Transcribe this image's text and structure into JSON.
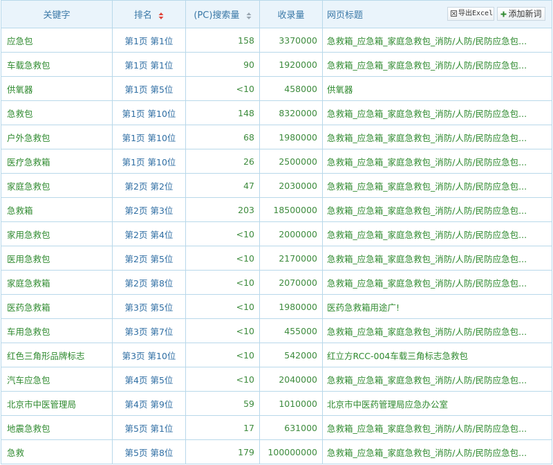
{
  "header": {
    "keyword": "关键字",
    "rank": "排名",
    "search_volume": "(PC)搜索量",
    "index_volume": "收录量",
    "page_title": "网页标题",
    "export_button": "导出Excel",
    "add_button": "添加新词"
  },
  "colors": {
    "header_bg": "#eaf4fb",
    "border": "#b8d8ea",
    "green_text": "#2f8a2f",
    "blue_text": "#2f6ea3",
    "sort_active": "#e0463c",
    "sort_inactive": "#9aa7b2"
  },
  "rows": [
    {
      "keyword": "应急包",
      "rank": "第1页 第1位",
      "search": "158",
      "index": "3370000",
      "title": "急救箱_应急箱_家庭急救包_消防/人防/民防应急包..."
    },
    {
      "keyword": "车载急救包",
      "rank": "第1页 第1位",
      "search": "90",
      "index": "1920000",
      "title": "急救箱_应急箱_家庭急救包_消防/人防/民防应急包..."
    },
    {
      "keyword": "供氧器",
      "rank": "第1页 第5位",
      "search": "<10",
      "index": "458000",
      "title": "供氧器"
    },
    {
      "keyword": "急救包",
      "rank": "第1页 第10位",
      "search": "148",
      "index": "8320000",
      "title": "急救箱_应急箱_家庭急救包_消防/人防/民防应急包..."
    },
    {
      "keyword": "户外急救包",
      "rank": "第1页 第10位",
      "search": "68",
      "index": "1980000",
      "title": "急救箱_应急箱_家庭急救包_消防/人防/民防应急包..."
    },
    {
      "keyword": "医疗急救箱",
      "rank": "第1页 第10位",
      "search": "26",
      "index": "2500000",
      "title": "急救箱_应急箱_家庭急救包_消防/人防/民防应急包..."
    },
    {
      "keyword": "家庭急救包",
      "rank": "第2页 第2位",
      "search": "47",
      "index": "2030000",
      "title": "急救箱_应急箱_家庭急救包_消防/人防/民防应急包..."
    },
    {
      "keyword": "急救箱",
      "rank": "第2页 第3位",
      "search": "203",
      "index": "18500000",
      "title": "急救箱_应急箱_家庭急救包_消防/人防/民防应急包..."
    },
    {
      "keyword": "家用急救包",
      "rank": "第2页 第4位",
      "search": "<10",
      "index": "2000000",
      "title": "急救箱_应急箱_家庭急救包_消防/人防/民防应急包..."
    },
    {
      "keyword": "医用急救包",
      "rank": "第2页 第5位",
      "search": "<10",
      "index": "2170000",
      "title": "急救箱_应急箱_家庭急救包_消防/人防/民防应急包..."
    },
    {
      "keyword": "家庭急救箱",
      "rank": "第2页 第8位",
      "search": "<10",
      "index": "2070000",
      "title": "急救箱_应急箱_家庭急救包_消防/人防/民防应急包..."
    },
    {
      "keyword": "医药急救箱",
      "rank": "第3页 第5位",
      "search": "<10",
      "index": "1980000",
      "title": "医药急救箱用途广!"
    },
    {
      "keyword": "车用急救包",
      "rank": "第3页 第7位",
      "search": "<10",
      "index": "455000",
      "title": "急救箱_应急箱_家庭急救包_消防/人防/民防应急包..."
    },
    {
      "keyword": "红色三角形品牌标志",
      "rank": "第3页 第10位",
      "search": "<10",
      "index": "542000",
      "title": "红立方RCC-004车载三角标志急救包"
    },
    {
      "keyword": "汽车应急包",
      "rank": "第4页 第5位",
      "search": "<10",
      "index": "2040000",
      "title": "急救箱_应急箱_家庭急救包_消防/人防/民防应急包..."
    },
    {
      "keyword": "北京市中医管理局",
      "rank": "第4页 第9位",
      "search": "59",
      "index": "1010000",
      "title": "北京市中医药管理局应急办公室"
    },
    {
      "keyword": "地震急救包",
      "rank": "第5页 第1位",
      "search": "17",
      "index": "631000",
      "title": "急救箱_应急箱_家庭急救包_消防/人防/民防应急包..."
    },
    {
      "keyword": "急救",
      "rank": "第5页 第8位",
      "search": "179",
      "index": "100000000",
      "title": "急救箱_应急箱_家庭急救包_消防/人防/民防应急包..."
    }
  ]
}
